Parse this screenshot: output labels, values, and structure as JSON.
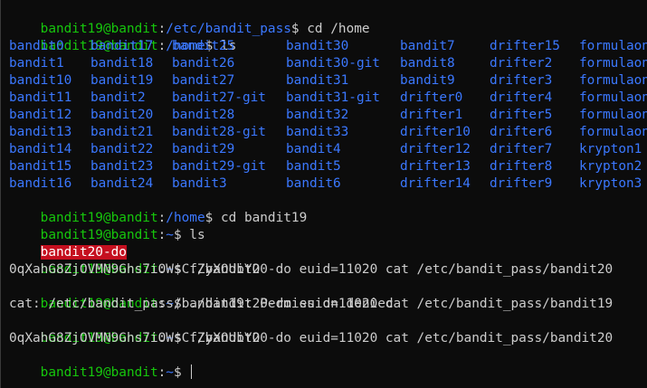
{
  "prompt": {
    "user_host": "bandit19@bandit",
    "colon": ":",
    "dollar": "$ "
  },
  "top_partial": {
    "path": "/etc/bandit_pass",
    "command": "cd /home"
  },
  "home_ls": {
    "path": "/home",
    "command": "ls",
    "rows": [
      [
        "bandit0",
        "bandit17",
        "bandit25",
        "bandit30",
        "bandit7",
        "drifter15",
        "formulaon"
      ],
      [
        "bandit1",
        "bandit18",
        "bandit26",
        "bandit30-git",
        "bandit8",
        "drifter2",
        "formulaon"
      ],
      [
        "bandit10",
        "bandit19",
        "bandit27",
        "bandit31",
        "bandit9",
        "drifter3",
        "formulaon"
      ],
      [
        "bandit11",
        "bandit2",
        "bandit27-git",
        "bandit31-git",
        "drifter0",
        "drifter4",
        "formulaon"
      ],
      [
        "bandit12",
        "bandit20",
        "bandit28",
        "bandit32",
        "drifter1",
        "drifter5",
        "formulaon"
      ],
      [
        "bandit13",
        "bandit21",
        "bandit28-git",
        "bandit33",
        "drifter10",
        "drifter6",
        "formulaon"
      ],
      [
        "bandit14",
        "bandit22",
        "bandit29",
        "bandit4",
        "drifter12",
        "drifter7",
        "krypton1"
      ],
      [
        "bandit15",
        "bandit23",
        "bandit29-git",
        "bandit5",
        "drifter13",
        "drifter8",
        "krypton2"
      ],
      [
        "bandit16",
        "bandit24",
        "bandit3",
        "bandit6",
        "drifter14",
        "drifter9",
        "krypton3"
      ]
    ]
  },
  "cd_line": {
    "path": "/home",
    "command": "cd bandit19"
  },
  "home19_ls": {
    "path": "~",
    "command": "ls",
    "output": "bandit20-do"
  },
  "run1": {
    "path": "~",
    "command": "./bandit20-do euid=11020 cat /etc/bandit_pass/bandit20",
    "output": "0qXahG8ZjOVMN9Ghs7iOWsCfZyXOUbYO"
  },
  "run2": {
    "path": "~",
    "command": "./bandit20-do euid=11020 cat /etc/bandit_pass/bandit19",
    "output": "cat: /etc/bandit_pass/bandit19: Permission denied"
  },
  "run3": {
    "path": "~",
    "command": "./bandit20-do euid=11020 cat /etc/bandit_pass/bandit20",
    "output": "0qXahG8ZjOVMN9Ghs7iOWsCfZyXOUbYO"
  },
  "final_prompt": {
    "path": "~"
  },
  "colors": {
    "background": "#0c0c0c",
    "user_host": "#16c60c",
    "path": "#3b78ff",
    "directory": "#3b78ff",
    "text": "#cccccc",
    "executable_highlight": "#c50f1f"
  }
}
